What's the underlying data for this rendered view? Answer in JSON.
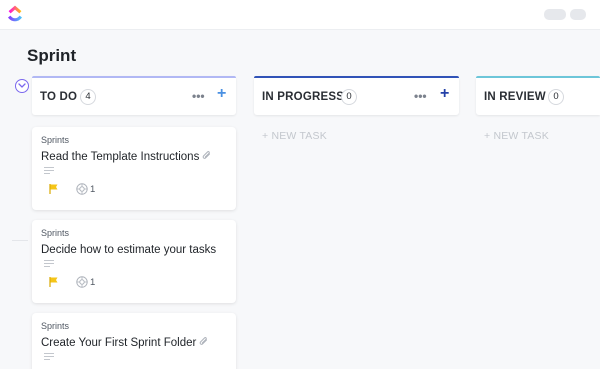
{
  "colors": {
    "accent": "#7b68ee",
    "todo_bar": "#b1b8f4",
    "in_progress_bar": "#3153b7",
    "in_review_bar": "#6dc6d9",
    "add_todo": "#4a90e2",
    "add_in_progress": "#2441a8",
    "flag": "#f5c518"
  },
  "page": {
    "title": "Sprint"
  },
  "columns": [
    {
      "title": "TO DO",
      "count": "4",
      "add_icon": "plus-icon",
      "more_icon": "more-icon"
    },
    {
      "title": "IN PROGRESS",
      "count": "0",
      "new_task": "+ NEW TASK",
      "add_icon": "plus-icon",
      "more_icon": "more-icon"
    },
    {
      "title": "IN REVIEW",
      "count": "0",
      "new_task": "+ NEW TASK"
    }
  ],
  "cards": [
    {
      "list": "Sprints",
      "title": "Read the Template Instructions",
      "has_attachment": true,
      "subtasks": "1",
      "priority_icon": "flag-icon"
    },
    {
      "list": "Sprints",
      "title": "Decide how to estimate your tasks",
      "has_attachment": false,
      "subtasks": "1",
      "priority_icon": "flag-icon"
    },
    {
      "list": "Sprints",
      "title": "Create Your First Sprint Folder",
      "has_attachment": true
    }
  ]
}
